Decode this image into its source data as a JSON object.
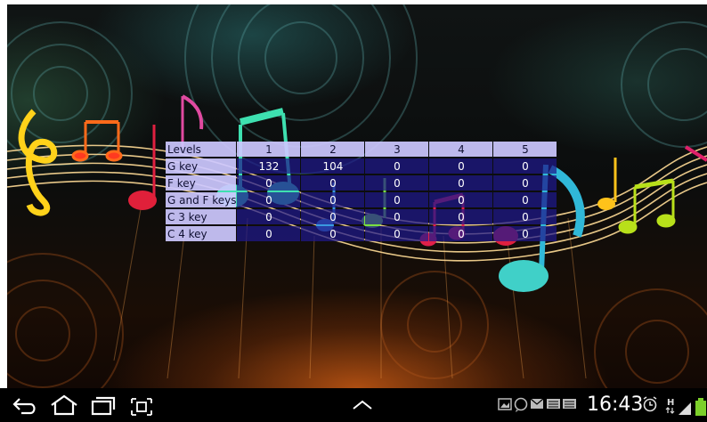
{
  "table": {
    "header": {
      "corner": "Levels",
      "levels": [
        "1",
        "2",
        "3",
        "4",
        "5"
      ]
    },
    "rows": [
      {
        "key": "G key",
        "values": [
          "132",
          "104",
          "0",
          "0",
          "0"
        ]
      },
      {
        "key": "F key",
        "values": [
          "0",
          "0",
          "0",
          "0",
          "0"
        ]
      },
      {
        "key": "G and F keys",
        "values": [
          "0",
          "0",
          "0",
          "0",
          "0"
        ]
      },
      {
        "key": "C 3 key",
        "values": [
          "0",
          "0",
          "0",
          "0",
          "0"
        ]
      },
      {
        "key": "C 4 key",
        "values": [
          "0",
          "0",
          "0",
          "0",
          "0"
        ]
      }
    ]
  },
  "system_bar": {
    "time": "16:43",
    "nav_icons": [
      "back-icon",
      "home-icon",
      "recent-apps-icon",
      "screenshot-icon",
      "up-chevron-icon"
    ],
    "status_icons": [
      "gallery-notification-icon",
      "whatsapp-notification-icon",
      "email-notification-icon",
      "keyboard-notification-icon",
      "keyboard-notification-icon",
      "alarm-icon",
      "hspa-data-icon",
      "signal-icon",
      "battery-icon"
    ]
  },
  "colors": {
    "table_header_bg": "#cdc8ff",
    "table_cell_bg": "#1e198c",
    "system_bar_bg": "#000000",
    "battery": "#7cd02a"
  }
}
